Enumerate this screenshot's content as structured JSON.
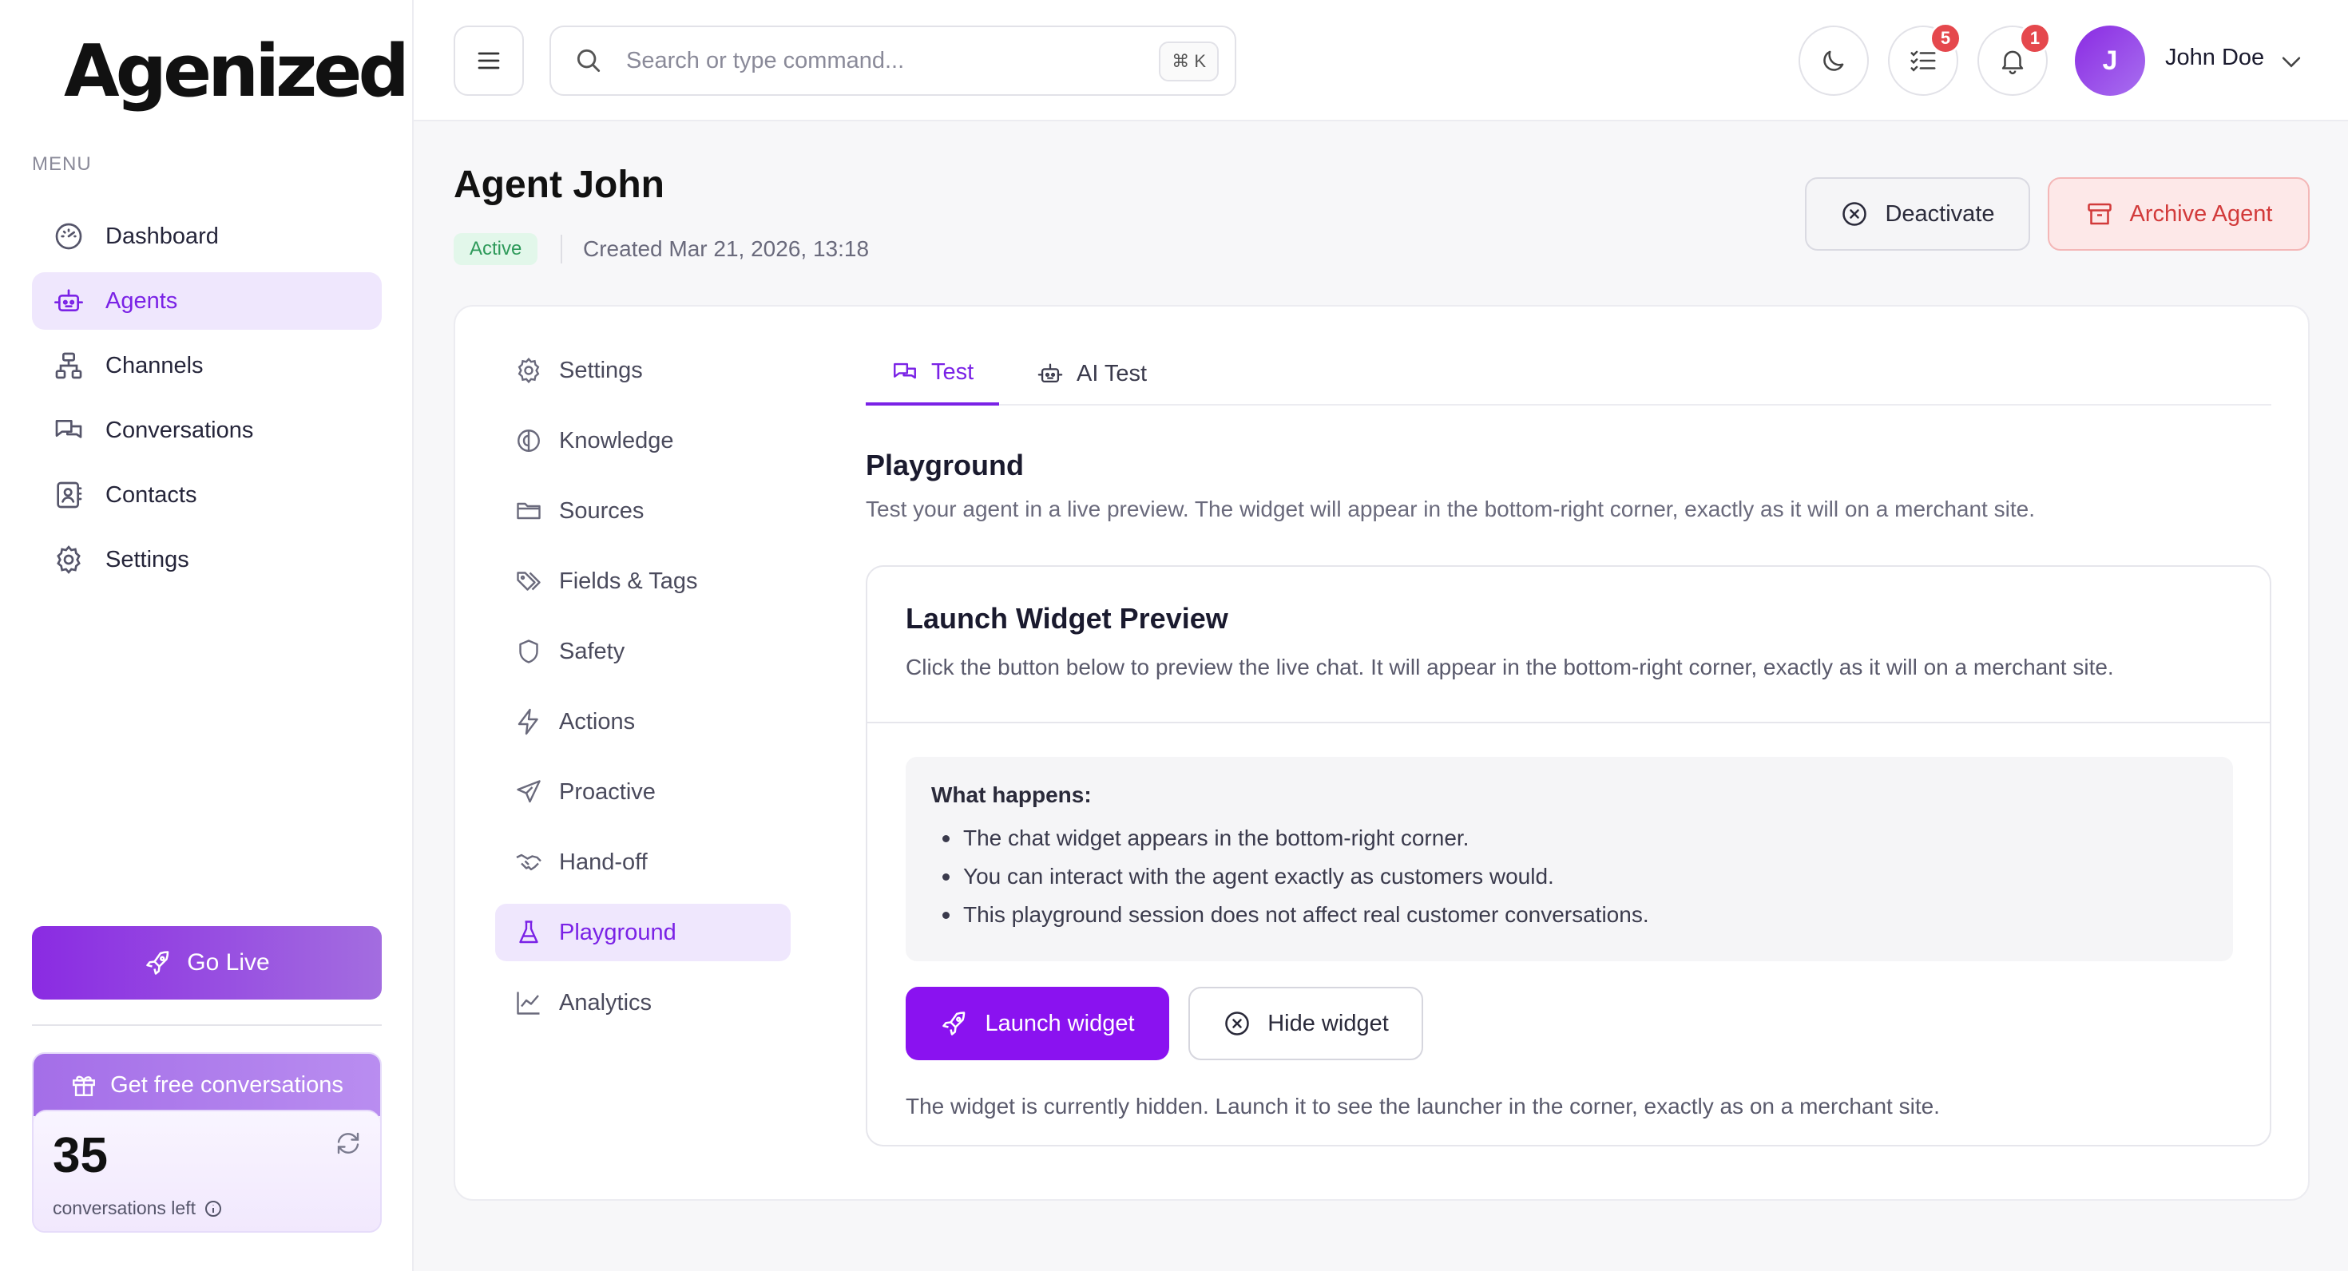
{
  "brand": {
    "logo_text": "Agenized",
    "accent": "#7a22e6"
  },
  "sidebar": {
    "menu_label": "MENU",
    "items": [
      {
        "label": "Dashboard",
        "icon": "gauge-icon",
        "active": false
      },
      {
        "label": "Agents",
        "icon": "robot-icon",
        "active": true
      },
      {
        "label": "Channels",
        "icon": "network-icon",
        "active": false
      },
      {
        "label": "Conversations",
        "icon": "chat-bubbles-icon",
        "active": false
      },
      {
        "label": "Contacts",
        "icon": "contact-card-icon",
        "active": false
      },
      {
        "label": "Settings",
        "icon": "gear-icon",
        "active": false
      }
    ],
    "go_live_label": "Go Live",
    "free_conversations": {
      "title": "Get free conversations",
      "count": "35",
      "label": "conversations left"
    }
  },
  "header": {
    "search_placeholder": "Search or type command...",
    "search_shortcut": "⌘ K",
    "tasks_badge": "5",
    "notifications_badge": "1",
    "user_initial": "J",
    "user_name": "John Doe"
  },
  "page": {
    "title": "Agent John",
    "status": "Active",
    "created": "Created Mar 21, 2026, 13:18",
    "deactivate_label": "Deactivate",
    "archive_label": "Archive Agent"
  },
  "subnav": {
    "items": [
      {
        "label": "Settings",
        "icon": "gear-icon",
        "active": false
      },
      {
        "label": "Knowledge",
        "icon": "brain-icon",
        "active": false
      },
      {
        "label": "Sources",
        "icon": "folder-icon",
        "active": false
      },
      {
        "label": "Fields & Tags",
        "icon": "tags-icon",
        "active": false
      },
      {
        "label": "Safety",
        "icon": "shield-icon",
        "active": false
      },
      {
        "label": "Actions",
        "icon": "lightning-icon",
        "active": false
      },
      {
        "label": "Proactive",
        "icon": "send-icon",
        "active": false
      },
      {
        "label": "Hand-off",
        "icon": "handshake-icon",
        "active": false
      },
      {
        "label": "Playground",
        "icon": "flask-icon",
        "active": true
      },
      {
        "label": "Analytics",
        "icon": "line-chart-icon",
        "active": false
      }
    ]
  },
  "tabs": [
    {
      "label": "Test",
      "icon": "chat-bubbles-icon",
      "active": true
    },
    {
      "label": "AI Test",
      "icon": "robot-icon",
      "active": false
    }
  ],
  "playground": {
    "title": "Playground",
    "description": "Test your agent in a live preview. The widget will appear in the bottom-right corner, exactly as it will on a merchant site.",
    "card_title": "Launch Widget Preview",
    "card_description": "Click the button below to preview the live chat. It will appear in the bottom-right corner, exactly as it will on a merchant site.",
    "info_title": "What happens:",
    "info_items": [
      "The chat widget appears in the bottom-right corner.",
      "You can interact with the agent exactly as customers would.",
      "This playground session does not affect real customer conversations."
    ],
    "launch_label": "Launch widget",
    "hide_label": "Hide widget",
    "hidden_note": "The widget is currently hidden. Launch it to see the launcher in the corner, exactly as on a merchant site."
  }
}
